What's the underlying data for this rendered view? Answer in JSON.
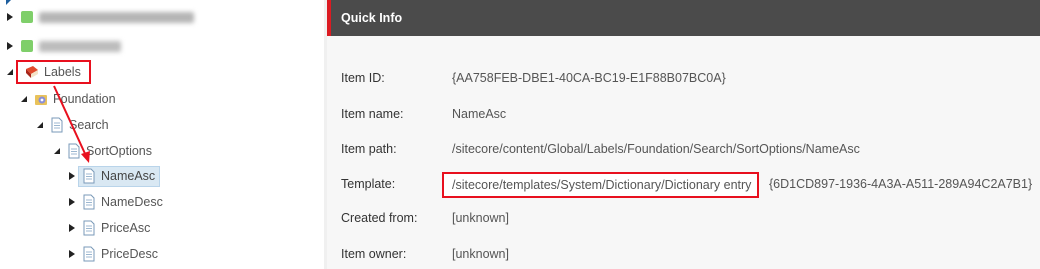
{
  "tree": {
    "nodes": [
      {
        "label": "Labels",
        "icon": "dictionary-book-icon"
      },
      {
        "label": "Foundation",
        "icon": "folder-gear-icon"
      },
      {
        "label": "Search",
        "icon": "document-icon"
      },
      {
        "label": "SortOptions",
        "icon": "document-icon"
      },
      {
        "label": "NameAsc",
        "icon": "document-icon",
        "selected": true
      },
      {
        "label": "NameDesc",
        "icon": "document-icon"
      },
      {
        "label": "PriceAsc",
        "icon": "document-icon"
      },
      {
        "label": "PriceDesc",
        "icon": "document-icon"
      }
    ]
  },
  "quick_info": {
    "title": "Quick Info",
    "rows": {
      "item_id": {
        "label": "Item ID:",
        "value": "{AA758FEB-DBE1-40CA-BC19-E1F88B07BC0A}"
      },
      "item_name": {
        "label": "Item name:",
        "value": "NameAsc"
      },
      "item_path": {
        "label": "Item path:",
        "value": "/sitecore/content/Global/Labels/Foundation/Search/SortOptions/NameAsc"
      },
      "template": {
        "label": "Template:",
        "path": "/sitecore/templates/System/Dictionary/Dictionary entry",
        "id": "{6D1CD897-1936-4A3A-A511-289A94C2A7B1}"
      },
      "created_from": {
        "label": "Created from:",
        "value": "[unknown]"
      },
      "item_owner": {
        "label": "Item owner:",
        "value": "[unknown]"
      }
    }
  },
  "colors": {
    "header_bg": "#4b4b4b",
    "header_accent": "#dc1b22",
    "highlight_red": "#e8101e",
    "selected_bg": "#d9e8f3",
    "panel_bg": "#f7f7f7"
  }
}
